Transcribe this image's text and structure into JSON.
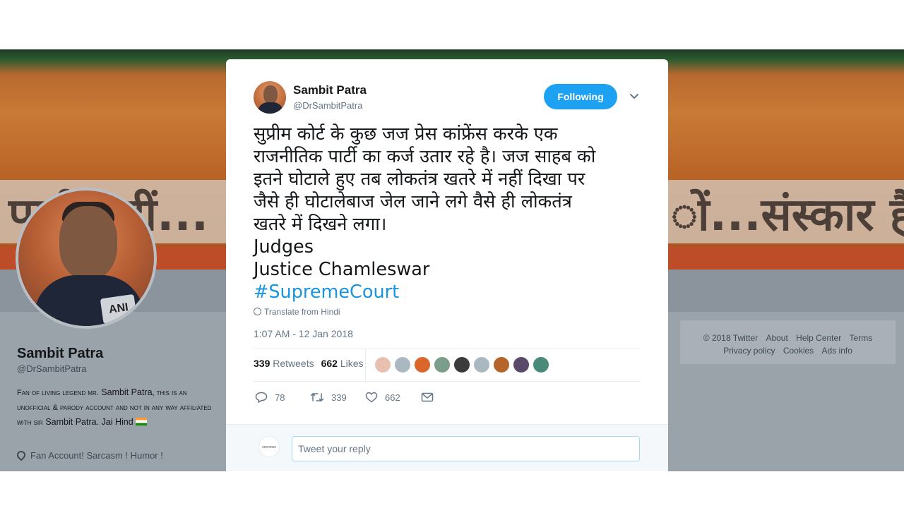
{
  "profile": {
    "name": "Sambit Patra",
    "handle": "@DrSambitPatra",
    "bio_part1": "Fan of living legend mr.",
    "bio_name1": "Sambit Patra",
    "bio_part2": ", this is an unofficial & parody account and not in any way affiliated with sir",
    "bio_name2": "Sambit Patra",
    "bio_part3": ". Jai Hind",
    "location": "Fan Account! Sarcasm ! Humor !",
    "banner_text_left": "पार्टी नहीं...",
    "banner_text_right": "ों...संस्कार है"
  },
  "footer": {
    "links": [
      "© 2018 Twitter",
      "About",
      "Help Center",
      "Terms",
      "Privacy policy",
      "Cookies",
      "Ads info"
    ]
  },
  "tweet": {
    "author_name": "Sambit Patra",
    "author_handle": "@DrSambitPatra",
    "follow_label": "Following",
    "text_lines": [
      "सुप्रीम कोर्ट के कुछ जज प्रेस कांफ्रेंस करके एक",
      "राजनीतिक पार्टी का कर्ज उतार रहे है। जज साहब को",
      "इतने घोटाले हुए तब लोकतंत्र खतरे में नहीं दिखा पर",
      "जैसे ही घोटालेबाज जेल जाने लगे वैसे ही लोकतंत्र",
      "खतरे में दिखने लगा।",
      "Judges",
      "Justice Chamleswar"
    ],
    "hashtag": "#SupremeCourt",
    "translate_label": "Translate from Hindi",
    "timestamp": "1:07 AM - 12 Jan 2018",
    "retweets_count": "339",
    "retweets_label": "Retweets",
    "likes_count": "662",
    "likes_label": "Likes",
    "liker_colors": [
      "#e8c0b0",
      "#aab8c2",
      "#d9662a",
      "#7a9e8a",
      "#3b3b3b",
      "#aab8c2",
      "#b5642a",
      "#5a4a6a",
      "#4a8a7a"
    ],
    "actions": {
      "reply_count": "78",
      "retweet_count": "339",
      "like_count": "662"
    },
    "reply_placeholder": "Tweet your reply",
    "reply_avatar_text": "zeenews"
  },
  "icons": {
    "reply": "reply-icon",
    "retweet": "retweet-icon",
    "like": "heart-icon",
    "message": "envelope-icon",
    "caret": "chevron-down-icon",
    "globe": "globe-icon",
    "location": "location-pin-icon"
  },
  "colors": {
    "accent": "#1da1f2",
    "hashtag": "#1b95e0",
    "muted": "#657786"
  }
}
